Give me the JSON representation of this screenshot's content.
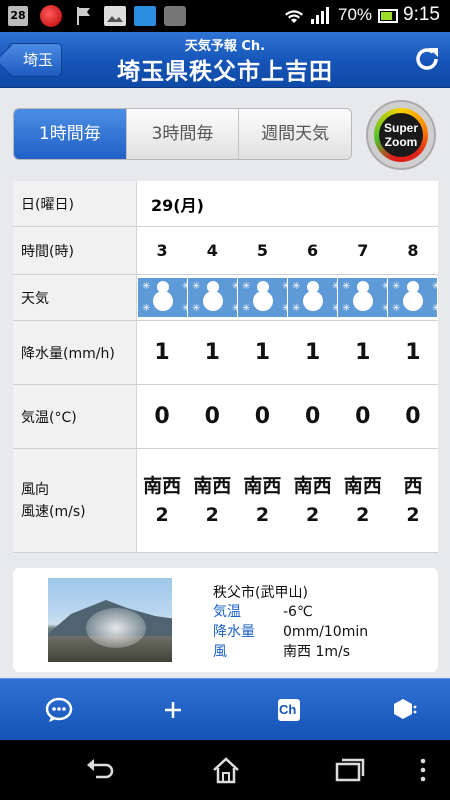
{
  "status_bar": {
    "notif_badge": "28",
    "battery_text": "70%",
    "time": "9:15",
    "icons": [
      "calendar-icon",
      "app-icon",
      "flag-icon",
      "image-icon",
      "app-icon",
      "shop-icon",
      "wifi-icon",
      "signal-icon",
      "battery-icon"
    ]
  },
  "header": {
    "back_label": "埼玉",
    "subtitle": "天気予報 Ch.",
    "title": "埼玉県秩父市上吉田",
    "refresh_icon": "refresh-icon"
  },
  "tabs": [
    {
      "label": "1時間毎",
      "active": true
    },
    {
      "label": "3時間毎",
      "active": false
    },
    {
      "label": "週間天気",
      "active": false
    }
  ],
  "superzoom": {
    "line1": "Super",
    "line2": "Zoom"
  },
  "table": {
    "labels": {
      "date": "日(曜日)",
      "hour": "時間(時)",
      "weather": "天気",
      "precip": "降水量(mm/h)",
      "temp": "気温(°C)",
      "wind_line1": "風向",
      "wind_line2": "風速(m/s)"
    },
    "date": "29(月)",
    "hours": [
      "3",
      "4",
      "5",
      "6",
      "7",
      "8"
    ],
    "weather_icons": [
      "snow-icon",
      "snow-icon",
      "snow-icon",
      "snow-icon",
      "snow-icon",
      "snow-icon"
    ],
    "precip": [
      "1",
      "1",
      "1",
      "1",
      "1",
      "1"
    ],
    "temp": [
      "0",
      "0",
      "0",
      "0",
      "0",
      "0"
    ],
    "wind_dir": [
      "南西",
      "南西",
      "南西",
      "南西",
      "南西",
      "西"
    ],
    "wind_speed": [
      "2",
      "2",
      "2",
      "2",
      "2",
      "2"
    ]
  },
  "live": {
    "location": "秩父市(武甲山)",
    "rows": [
      {
        "key": "気温",
        "value": "-6℃"
      },
      {
        "key": "降水量",
        "value": "0mm/10min"
      },
      {
        "key": "風",
        "value": "南西 1m/s"
      }
    ]
  },
  "toolbar": {
    "buttons": [
      "comment-icon",
      "plus-icon",
      "channel-icon",
      "settings-icon"
    ],
    "channel_label": "Ch"
  },
  "navbar": {
    "buttons": [
      "back-icon",
      "home-icon",
      "recent-apps-icon",
      "menu-icon"
    ]
  },
  "colors": {
    "header_blue": "#1553b7",
    "tab_active": "#2160c6",
    "weather_cell": "#5f9ad8",
    "live_key": "#1c5fc9"
  }
}
